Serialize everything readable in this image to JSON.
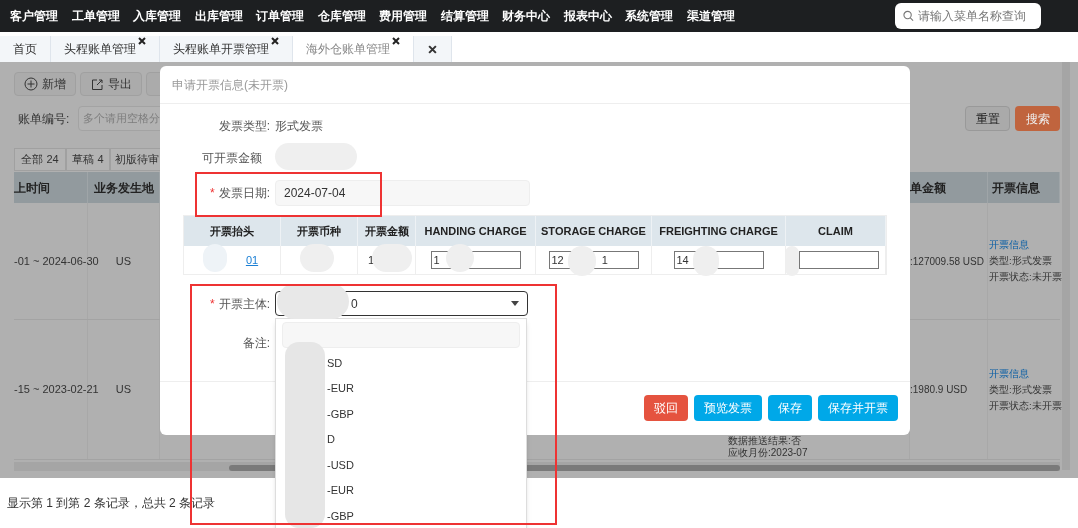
{
  "top_nav": {
    "items": [
      "客户管理",
      "工单管理",
      "入库管理",
      "出库管理",
      "订单管理",
      "仓库管理",
      "费用管理",
      "结算管理",
      "财务中心",
      "报表中心",
      "系统管理",
      "渠道管理"
    ],
    "search": {
      "placeholder": "请输入菜单名称查询"
    }
  },
  "tabs": [
    {
      "label": "首页",
      "selected": false,
      "closable": false
    },
    {
      "label": "头程账单管理",
      "selected": false,
      "closable": true
    },
    {
      "label": "头程账单开票管理",
      "selected": false,
      "closable": true
    },
    {
      "label": "海外仓账单管理",
      "selected": true,
      "closable": true
    }
  ],
  "toolbar": [
    {
      "label": "新增",
      "kind": "add"
    },
    {
      "label": "导出",
      "kind": "export"
    },
    {
      "kind": "other"
    }
  ],
  "filter": {
    "label": "账单编号:",
    "placeholder": "多个请用空格分",
    "buttons": [
      {
        "label": "重置",
        "kind": "default"
      },
      {
        "label": "搜索",
        "kind": "search"
      }
    ]
  },
  "status_tabs": [
    "全部 24",
    "草稿 4",
    "初版待审"
  ],
  "table": {
    "columns": [
      "上时间",
      "业务发生地",
      "单金额",
      "开票信息"
    ],
    "rows": [
      {
        "period": "-01 ~ 2024-06-30",
        "region": "US",
        "amount": ":127009.58 USD",
        "info_link": "开票信息",
        "info_lines": [
          "类型:形式发票",
          "开票状态:未开票"
        ]
      },
      {
        "period": "-15 ~ 2023-02-21",
        "region": "US",
        "notes": [
          "数据推送结果:否",
          "应收月份:2023-07"
        ],
        "amount": ":1980.9 USD",
        "info_link": "开票信息",
        "info_lines": [
          "类型:形式发票",
          "开票状态:未开票"
        ]
      }
    ]
  },
  "pagination": "显示第 1 到第 2 条记录，总共 2 条记录",
  "modal": {
    "title": "申请开票信息(未开票)",
    "invoice_type": {
      "label": "发票类型:",
      "value": "形式发票"
    },
    "amount": {
      "label": "可开票金额"
    },
    "date": {
      "mark": "*",
      "label": "发票日期:",
      "value": "2024-07-04"
    },
    "charges": {
      "columns": [
        "开票抬头",
        "开票币种",
        "开票金额",
        "HANDING CHARGE",
        "STORAGE CHARGE",
        "FREIGHTING CHARGE",
        "CLAIM"
      ],
      "row": {
        "header_link": "01",
        "amount": "1",
        "handing": "1",
        "storage": "12",
        "storage_tail": "1",
        "freighting": "14"
      }
    },
    "subject": {
      "mark": "*",
      "label": "开票主体:",
      "value": "0"
    },
    "remark": {
      "label": "备注:"
    },
    "buttons": [
      {
        "label": "驳回",
        "kind": "danger"
      },
      {
        "label": "预览发票",
        "kind": "primary"
      },
      {
        "label": "保存",
        "kind": "primary"
      },
      {
        "label": "保存并开票",
        "kind": "primary"
      }
    ]
  },
  "dropdown": {
    "options": [
      "SD",
      "-EUR",
      "-GBP",
      "D",
      "-USD",
      "-EUR",
      "-GBP"
    ]
  }
}
